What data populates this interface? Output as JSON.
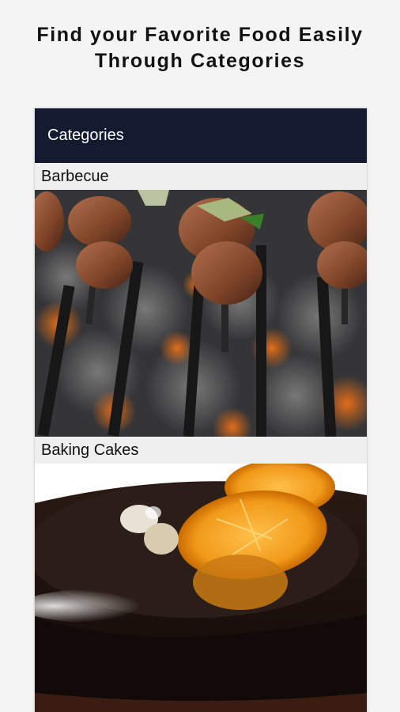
{
  "headline": {
    "line1": "Find your Favorite Food Easily",
    "line2": "Through Categories"
  },
  "app": {
    "title": "Categories",
    "accent_color": "#141a30"
  },
  "categories": [
    {
      "label": "Barbecue",
      "image": "barbecue-skewers-photo"
    },
    {
      "label": "Baking Cakes",
      "image": "chocolate-cake-photo"
    }
  ]
}
